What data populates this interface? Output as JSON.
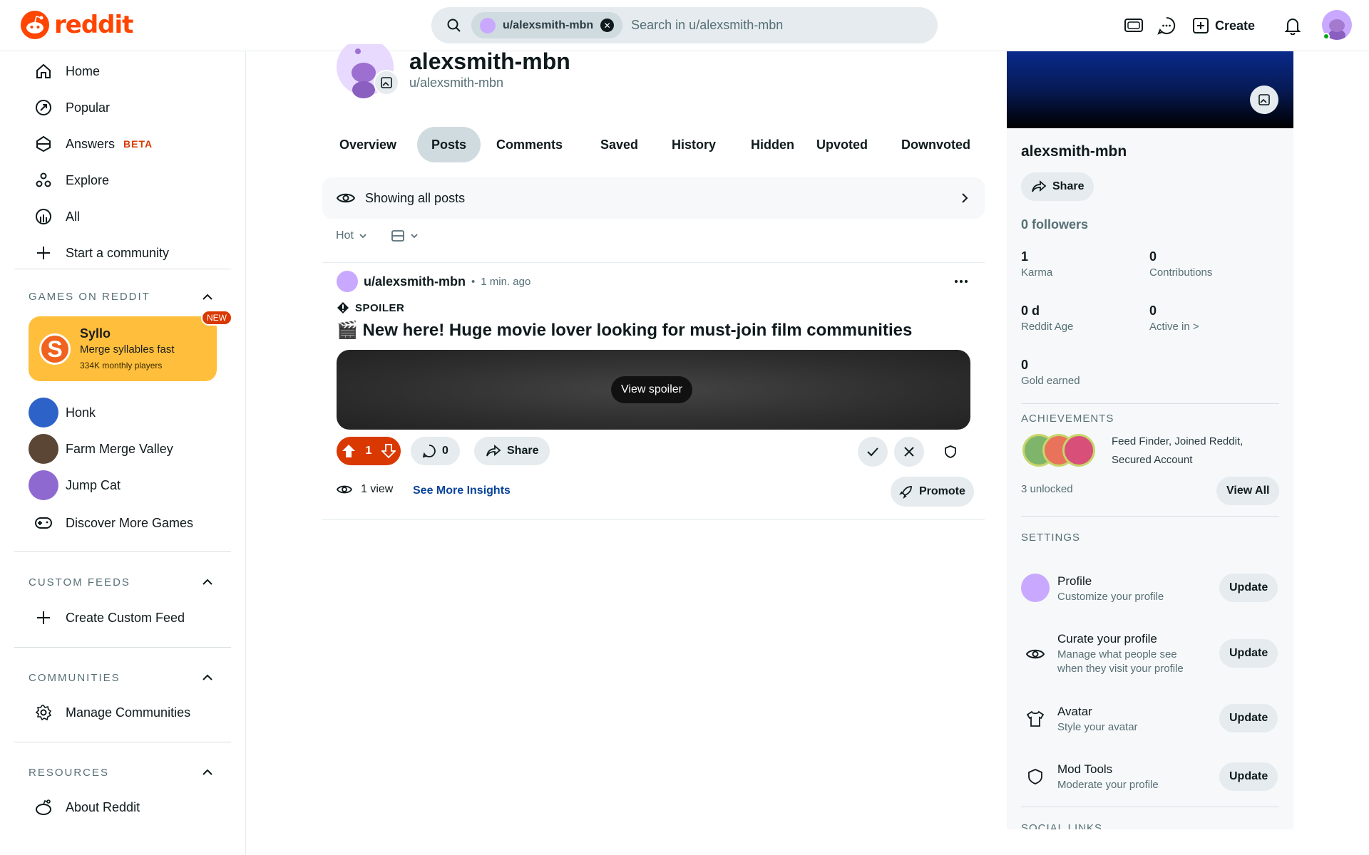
{
  "header": {
    "logo_text": "reddit",
    "search": {
      "chip_label": "u/alexsmith-mbn",
      "placeholder": "Search in u/alexsmith-mbn"
    },
    "create_label": "Create"
  },
  "sidebar": {
    "nav": [
      {
        "label": "Home",
        "icon": "home-icon"
      },
      {
        "label": "Popular",
        "icon": "popular-icon"
      },
      {
        "label": "Answers",
        "badge": "BETA",
        "icon": "answers-icon"
      },
      {
        "label": "Explore",
        "icon": "explore-icon"
      },
      {
        "label": "All",
        "icon": "all-icon"
      },
      {
        "label": "Start a community",
        "icon": "plus-icon"
      }
    ],
    "games_title": "GAMES ON REDDIT",
    "featured_game": {
      "name": "Syllo",
      "desc": "Merge syllables fast",
      "players": "334K monthly players",
      "badge": "NEW"
    },
    "games": [
      "Honk",
      "Farm Merge Valley",
      "Jump Cat",
      "Discover More Games"
    ],
    "custom_feeds_title": "CUSTOM FEEDS",
    "create_custom_feed": "Create Custom Feed",
    "communities_title": "COMMUNITIES",
    "manage_communities": "Manage Communities",
    "resources_title": "RESOURCES",
    "about_reddit": "About Reddit"
  },
  "profile": {
    "display_name": "alexsmith-mbn",
    "handle": "u/alexsmith-mbn",
    "tabs": [
      "Overview",
      "Posts",
      "Comments",
      "Saved",
      "History",
      "Hidden",
      "Upvoted",
      "Downvoted"
    ],
    "active_tab": "Posts",
    "filter_label": "Showing all posts",
    "sort": "Hot"
  },
  "post": {
    "author": "u/alexsmith-mbn",
    "separator": "•",
    "time": "1 min. ago",
    "spoiler_label": "SPOILER",
    "title": "🎬 New here! Huge movie lover looking for must-join film communities",
    "view_spoiler": "View spoiler",
    "votes": "1",
    "comments": "0",
    "share": "Share",
    "views": "1 view",
    "see_more": "See More Insights",
    "promote": "Promote"
  },
  "right": {
    "name": "alexsmith-mbn",
    "share": "Share",
    "followers": "0 followers",
    "stats": [
      {
        "value": "1",
        "label": "Karma"
      },
      {
        "value": "0",
        "label": "Contributions"
      },
      {
        "value": "0 d",
        "label": "Reddit Age"
      },
      {
        "value": "0",
        "label": "Active in >"
      },
      {
        "value": "0",
        "label": "Gold earned"
      }
    ],
    "achievements_title": "ACHIEVEMENTS",
    "achievements_names": "Feed Finder, Joined Reddit, Secured Account",
    "achievements_unlocked": "3 unlocked",
    "view_all": "View All",
    "settings_title": "SETTINGS",
    "settings": [
      {
        "title": "Profile",
        "sub": "Customize your profile",
        "btn": "Update",
        "icon": "avatar-icon"
      },
      {
        "title": "Curate your profile",
        "sub": "Manage what people see when they visit your profile",
        "btn": "Update",
        "icon": "eye-icon"
      },
      {
        "title": "Avatar",
        "sub": "Style your avatar",
        "btn": "Update",
        "icon": "shirt-icon"
      },
      {
        "title": "Mod Tools",
        "sub": "Moderate your profile",
        "btn": "Update",
        "icon": "shield-icon"
      }
    ],
    "social_links_title": "SOCIAL LINKS"
  },
  "colors": {
    "brand": "#ff4500",
    "upvote_active": "#d93900",
    "link": "#0a449b",
    "game_card": "#ffbf3c"
  }
}
